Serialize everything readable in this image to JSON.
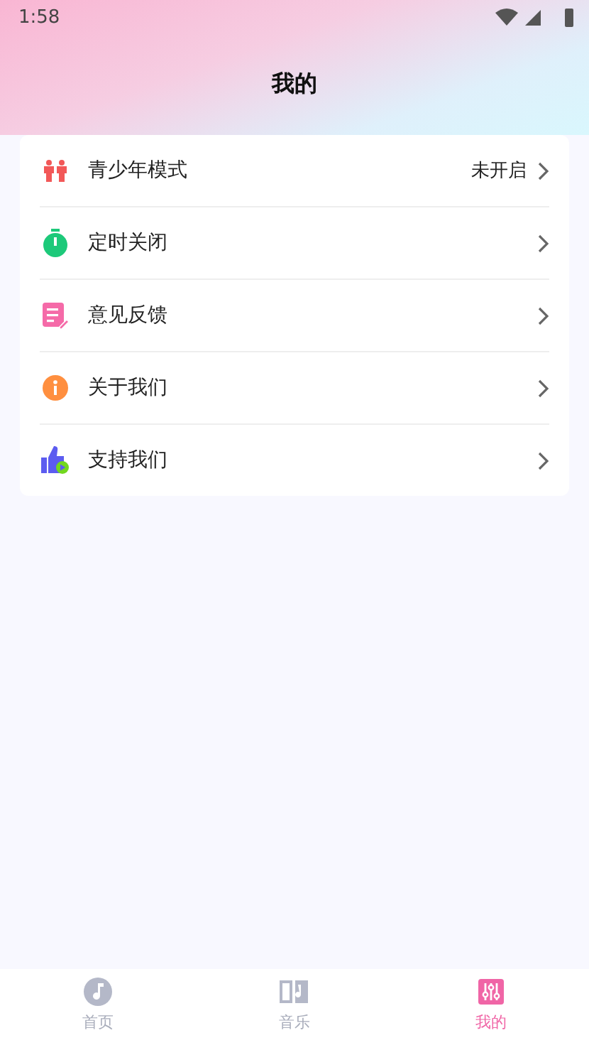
{
  "status_bar": {
    "time": "1:58"
  },
  "title": "我的",
  "menu": [
    {
      "kind": "youth",
      "label": "青少年模式",
      "value": "未开启"
    },
    {
      "kind": "timer",
      "label": "定时关闭"
    },
    {
      "kind": "feedback",
      "label": "意见反馈"
    },
    {
      "kind": "about",
      "label": "关于我们"
    },
    {
      "kind": "support",
      "label": "支持我们"
    }
  ],
  "tabs": [
    {
      "kind": "home",
      "label": "首页",
      "selected": false
    },
    {
      "kind": "music",
      "label": "音乐",
      "selected": false
    },
    {
      "kind": "mine",
      "label": "我的",
      "selected": true
    }
  ]
}
